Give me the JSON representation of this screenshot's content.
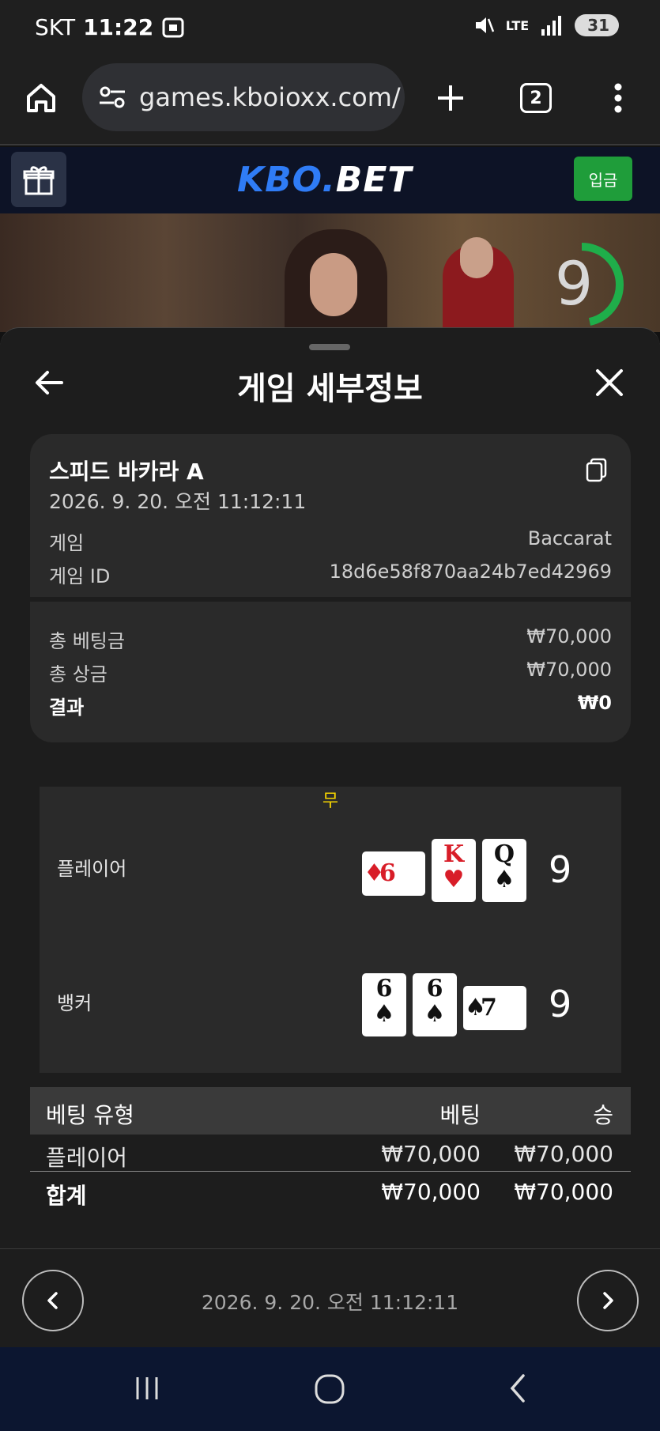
{
  "status_bar": {
    "carrier": "SKT",
    "time": "11:22",
    "network": "LTE",
    "battery": "31"
  },
  "browser": {
    "url": "games.kboioxx.com/",
    "tab_count": "2"
  },
  "site": {
    "logo_part1": "KBO.",
    "logo_part2": "BET",
    "deposit_label": "입금",
    "timer_value": "9"
  },
  "sheet": {
    "title": "게임 세부정보",
    "game_name": "스피드 바카라 A",
    "game_datetime": "2026. 9. 20. 오전 11:12:11",
    "game_label": "게임",
    "game_value": "Baccarat",
    "game_id_label": "게임 ID",
    "game_id_value": "18d6e58f870aa24b7ed42969",
    "total_bet_label": "총 베팅금",
    "total_bet_value": "₩70,000",
    "total_win_label": "총 상금",
    "total_win_value": "₩70,000",
    "result_label": "결과",
    "result_value": "₩0"
  },
  "board": {
    "outcome": "무",
    "player_label": "플레이어",
    "player_score": "9",
    "player_cards": [
      {
        "rank": "6",
        "suit": "♦",
        "color": "#d81d28",
        "rotated": true
      },
      {
        "rank": "K",
        "suit": "♥",
        "color": "#d81d28",
        "rotated": false
      },
      {
        "rank": "Q",
        "suit": "♠",
        "color": "#111111",
        "rotated": false
      }
    ],
    "banker_label": "뱅커",
    "banker_score": "9",
    "banker_cards": [
      {
        "rank": "6",
        "suit": "♠",
        "color": "#111111",
        "rotated": false
      },
      {
        "rank": "6",
        "suit": "♠",
        "color": "#111111",
        "rotated": false
      },
      {
        "rank": "7",
        "suit": "♠",
        "color": "#111111",
        "rotated": true
      }
    ]
  },
  "bets": {
    "col_type": "베팅 유형",
    "col_bet": "베팅",
    "col_win": "승",
    "rows": [
      {
        "type": "플레이어",
        "bet": "₩70,000",
        "win": "₩70,000"
      }
    ],
    "total_label": "합계",
    "total_bet": "₩70,000",
    "total_win": "₩70,000"
  },
  "footer": {
    "date": "2026. 9. 20. 오전 11:12:11"
  }
}
